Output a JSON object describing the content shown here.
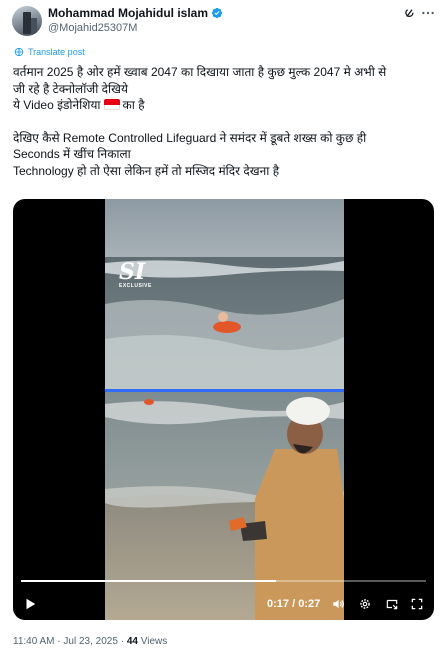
{
  "author": {
    "display_name": "Mohammad Mojahidul islam",
    "handle": "@Mojahid25307M"
  },
  "translate_label": "Translate post",
  "tweet_lines": {
    "l1": "वर्तमान 2025 है ओर हमें ख्वाब 2047 का दिखाया जाता है कुछ मुल्क 2047 मे अभी से",
    "l2": "जी रहे है टेक्नोलॉजी देखिये",
    "l3a": "ये Video इंडोनेशिया",
    "l3b": "का है",
    "l4": "देखिए कैसे Remote Controlled Lifeguard ने समंदर में डूबते शख्स को कुछ ही",
    "l5": "Seconds में खींच निकाला",
    "l6": "Technology हो तो ऐसा लेकिन हमें तो मस्जिद मंदिर देखना है"
  },
  "video": {
    "watermark": "SI",
    "watermark_sub": "EXCLUSIVE",
    "time_current": "0:17",
    "time_total": "0:27",
    "progress_fraction": 0.63
  },
  "meta": {
    "time": "11:40 AM",
    "date": "Jul 23, 2025",
    "views_count": "44",
    "views_label": "Views",
    "separator": "·"
  },
  "colors": {
    "link_blue": "#1d9bf0",
    "verified_blue": "#1d9bf0",
    "flag_red": "#e70011",
    "flag_white": "#ffffff"
  },
  "icons": {
    "verified": "verified-badge-icon",
    "grok": "grok-icon",
    "more": "more-icon",
    "translate": "globe-icon",
    "play": "play-icon",
    "volume": "volume-icon",
    "settings": "settings-icon",
    "pip": "picture-in-picture-icon",
    "fullscreen": "fullscreen-icon"
  }
}
